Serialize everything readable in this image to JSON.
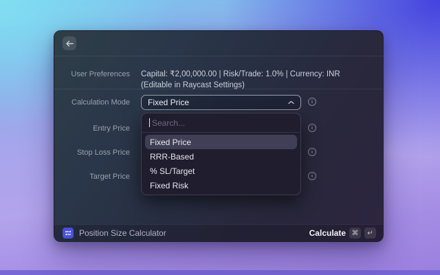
{
  "window_title": "Position Size Calculator",
  "form": {
    "user_preferences": {
      "label": "User Preferences",
      "value_line1": "Capital: ₹2,00,000.00 | Risk/Trade: 1.0% | Currency: INR",
      "value_line2": "(Editable in Raycast Settings)"
    },
    "fields": [
      {
        "label": "Calculation Mode",
        "value": "Fixed Price"
      },
      {
        "label": "Entry Price"
      },
      {
        "label": "Stop Loss Price"
      },
      {
        "label": "Target Price"
      }
    ]
  },
  "dropdown": {
    "search_placeholder": "Search...",
    "options": [
      {
        "label": "Fixed Price",
        "selected": true
      },
      {
        "label": "RRR-Based",
        "selected": false
      },
      {
        "label": "% SL/Target",
        "selected": false
      },
      {
        "label": "Fixed Risk",
        "selected": false
      }
    ]
  },
  "bottom_bar": {
    "title": "Position Size Calculator",
    "primary_action": "Calculate",
    "shortcut_keys": [
      "⌘",
      "↵"
    ]
  },
  "colors": {
    "accent_indigo": "#4b4fd8",
    "window_top_tint": "#2e3e47",
    "window_bottom_tint": "#2c2640",
    "dropdown_bg": "#1f1d2e",
    "option_highlight": "#413f55",
    "bg_gradient_top_left": "#80def2",
    "bg_gradient_top_right": "#403cde",
    "bg_gradient_bottom": "#9b80de"
  }
}
